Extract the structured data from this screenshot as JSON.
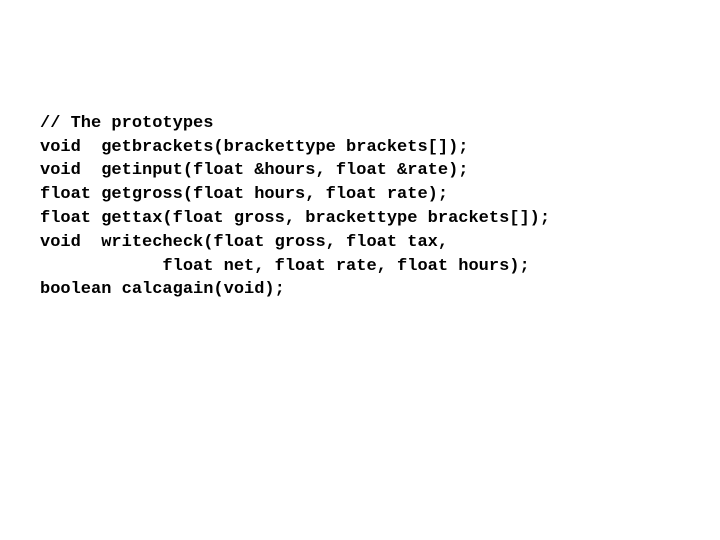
{
  "code": {
    "lines": [
      "// The prototypes",
      "void  getbrackets(brackettype brackets[]);",
      "void  getinput(float &hours, float &rate);",
      "float getgross(float hours, float rate);",
      "float gettax(float gross, brackettype brackets[]);",
      "void  writecheck(float gross, float tax,",
      "            float net, float rate, float hours);",
      "boolean calcagain(void);"
    ]
  }
}
